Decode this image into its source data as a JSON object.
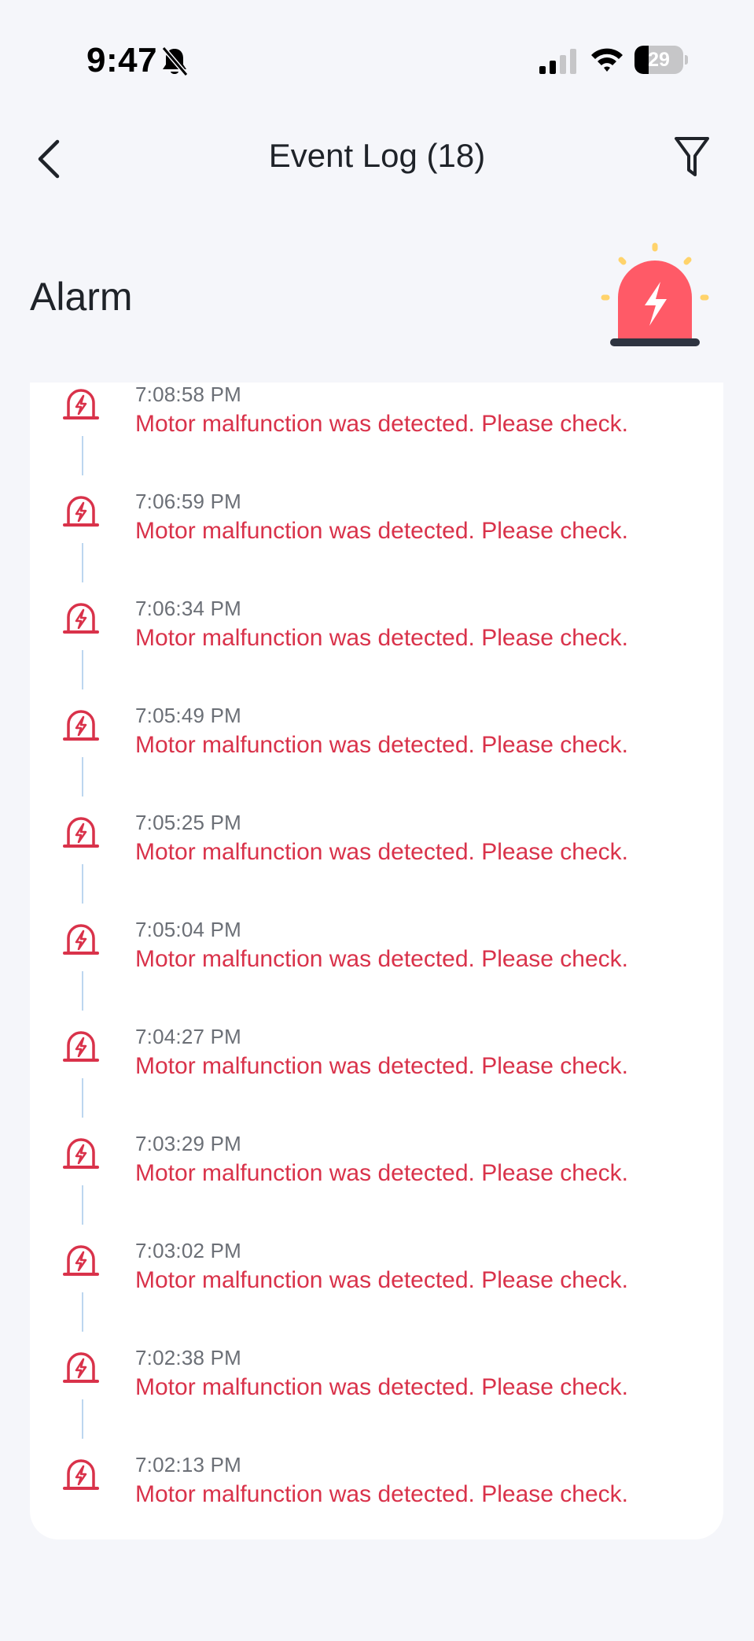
{
  "status_bar": {
    "time": "9:47",
    "battery_level": "29",
    "battery_fraction": 0.29,
    "icons": [
      "bell-off-icon",
      "signal-icon",
      "wifi-icon",
      "battery-icon"
    ]
  },
  "nav": {
    "title": "Event Log (18)",
    "back_icon": "chevron-left-icon",
    "filter_icon": "filter-icon"
  },
  "section": {
    "title": "Alarm",
    "illustration": "siren-icon"
  },
  "colors": {
    "alarm_red": "#d9324a",
    "siren_red": "#ff5a67",
    "siren_glow": "#ffd36b",
    "timeline_line": "#bcd6ef",
    "background": "#f5f6fa",
    "card": "#ffffff"
  },
  "events": [
    {
      "time": "7:08:58 PM",
      "message": "Motor malfunction was detected. Please check."
    },
    {
      "time": "7:06:59 PM",
      "message": "Motor malfunction was detected. Please check."
    },
    {
      "time": "7:06:34 PM",
      "message": "Motor malfunction was detected. Please check."
    },
    {
      "time": "7:05:49 PM",
      "message": "Motor malfunction was detected. Please check."
    },
    {
      "time": "7:05:25 PM",
      "message": "Motor malfunction was detected. Please check."
    },
    {
      "time": "7:05:04 PM",
      "message": "Motor malfunction was detected. Please check."
    },
    {
      "time": "7:04:27 PM",
      "message": "Motor malfunction was detected. Please check."
    },
    {
      "time": "7:03:29 PM",
      "message": "Motor malfunction was detected. Please check."
    },
    {
      "time": "7:03:02 PM",
      "message": "Motor malfunction was detected. Please check."
    },
    {
      "time": "7:02:38 PM",
      "message": "Motor malfunction was detected. Please check."
    },
    {
      "time": "7:02:13 PM",
      "message": "Motor malfunction was detected. Please check."
    }
  ]
}
